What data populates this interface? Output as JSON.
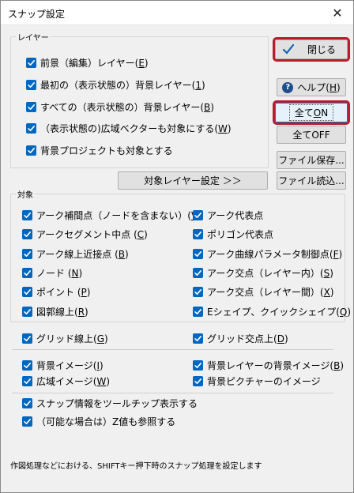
{
  "window": {
    "title": "スナップ設定",
    "close_glyph": "✕"
  },
  "layer_group": {
    "legend": "レイヤー",
    "items": [
      {
        "label": "前景（編集）レイヤー(",
        "key": "E",
        "tail": ")",
        "checked": true
      },
      {
        "label": "最初の（表示状態の）背景レイヤー(",
        "key": "1",
        "tail": ")",
        "checked": true
      },
      {
        "label": "すべての（表示状態の）背景レイヤー(",
        "key": "B",
        "tail": ")",
        "checked": true
      },
      {
        "label": "（表示状態の)広域ベクターも対象にする(",
        "key": "W",
        "tail": ")",
        "checked": true
      },
      {
        "label": "背景プロジェクトも対象とする",
        "key": "",
        "tail": "",
        "checked": true
      }
    ]
  },
  "buttons": {
    "close": "閉じる",
    "help_label": "ヘルプ(",
    "help_key": "H",
    "help_tail": ")",
    "all_on_pre": "全て",
    "all_on_key": "O",
    "all_on_post": "N",
    "all_off": "全てOFF",
    "save_file": "ファイル保存...",
    "load_file": "ファイル読込...",
    "target_layer": "対象レイヤー設定 ＞＞"
  },
  "target_group": {
    "legend": "対象",
    "left": [
      {
        "label": "アーク補間点（ノードを含まない）(",
        "key": "V",
        "tail": ")",
        "checked": true
      },
      {
        "label": "アークセグメント中点 (",
        "key": "C",
        "tail": ")",
        "checked": true
      },
      {
        "label": "アーク線上近接点 (",
        "key": "B",
        "tail": ")",
        "checked": true
      },
      {
        "label": "ノード (",
        "key": "N",
        "tail": ")",
        "checked": true
      },
      {
        "label": "ポイント (",
        "key": "P",
        "tail": ")",
        "checked": true
      },
      {
        "label": "図郭線上(",
        "key": "R",
        "tail": ")",
        "checked": true
      }
    ],
    "right": [
      {
        "label": "アーク代表点",
        "key": "",
        "tail": "",
        "checked": true
      },
      {
        "label": "ポリゴン代表点",
        "key": "",
        "tail": "",
        "checked": true
      },
      {
        "label": "アーク曲線パラメータ制御点(",
        "key": "F",
        "tail": ")",
        "checked": true
      },
      {
        "label": "アーク交点（レイヤー内）(",
        "key": "S",
        "tail": ")",
        "checked": true
      },
      {
        "label": "アーク交点（レイヤー間）(",
        "key": "X",
        "tail": ")",
        "checked": true
      },
      {
        "label": "Eシェイプ、クイックシェイプ(",
        "key": "Q",
        "tail": ")",
        "checked": true
      }
    ],
    "grid_left": {
      "label": "グリッド線上(",
      "key": "G",
      "tail": ")",
      "checked": true
    },
    "grid_right": {
      "label": "グリッド交点上(",
      "key": "D",
      "tail": ")",
      "checked": true
    },
    "image_left": [
      {
        "label": "背景イメージ(",
        "key": "I",
        "tail": ")",
        "checked": true
      },
      {
        "label": "広域イメージ(",
        "key": "W",
        "tail": ")",
        "checked": true
      }
    ],
    "image_right": [
      {
        "label": "背景レイヤーの背景イメージ(",
        "key": "B",
        "tail": ")",
        "checked": true
      },
      {
        "label": "背景ピクチャーのイメージ",
        "key": "",
        "tail": "",
        "checked": true
      }
    ],
    "bottom": [
      {
        "label": "スナップ情報をツールチップ表示する",
        "key": "",
        "tail": "",
        "checked": true
      },
      {
        "label": "（可能な場合は）Z値も参照する",
        "key": "",
        "tail": "",
        "checked": true
      }
    ]
  },
  "status_text": "作図処理などにおける、SHIFTキー押下時のスナップ処理を設定します",
  "colors": {
    "checkbox": "#0067c0",
    "highlight": "#b81d2c"
  }
}
